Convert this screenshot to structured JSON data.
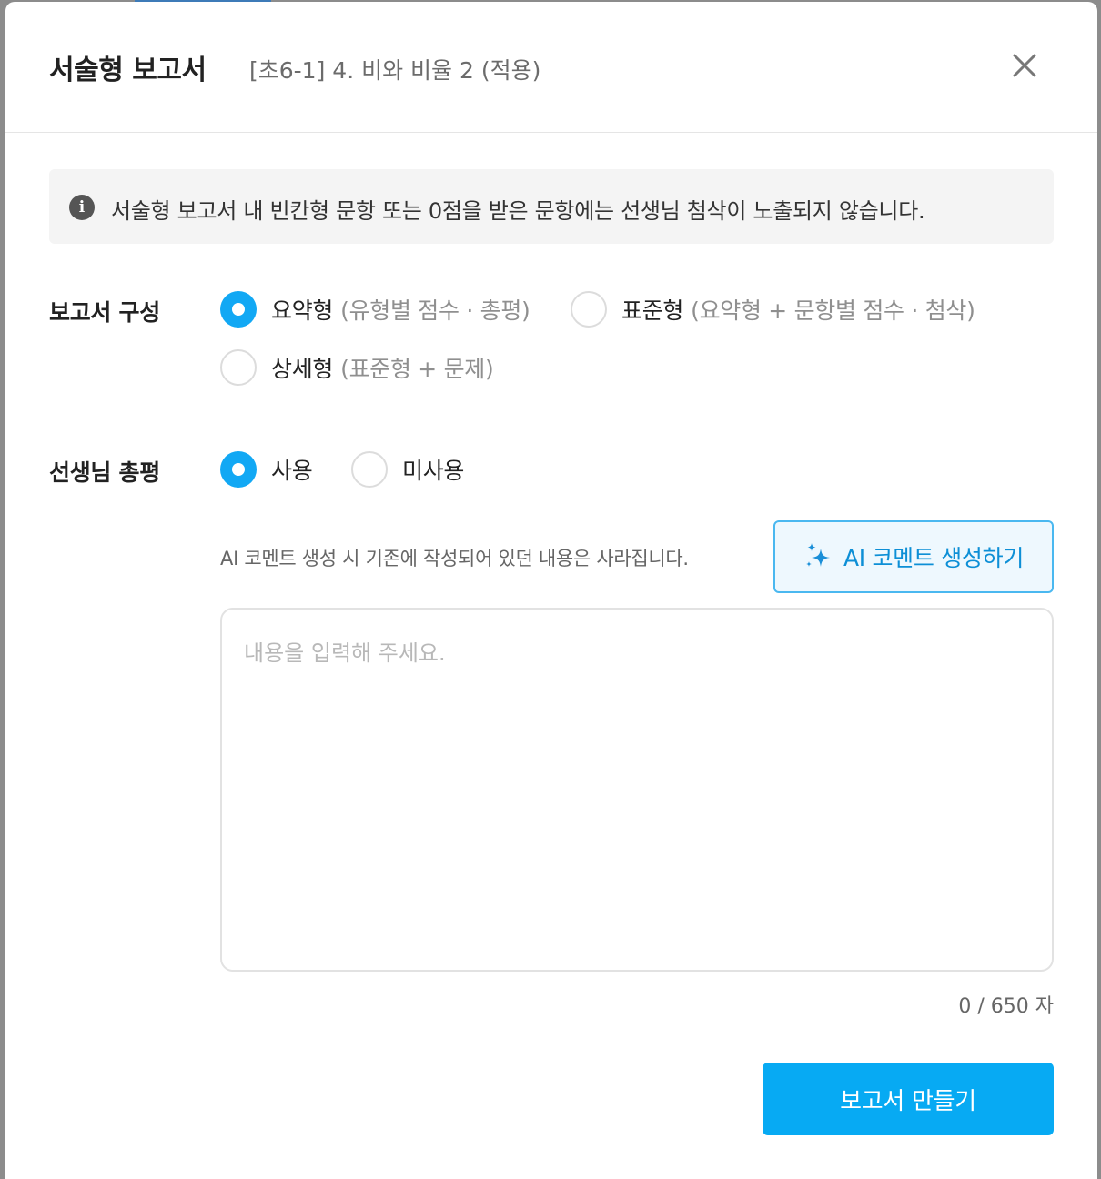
{
  "modal": {
    "title": "서술형 보고서",
    "subtitle": "[초6-1] 4. 비와 비율 2 (적용)"
  },
  "notice": {
    "icon": "info-icon",
    "text": "서술형 보고서 내 빈칸형 문항 또는 0점을 받은 문항에는 선생님 첨삭이 노출되지 않습니다."
  },
  "report_type": {
    "label": "보고서 구성",
    "selected": "요약형",
    "options": [
      {
        "label": "요약형",
        "sub": "(유형별 점수 · 총평)",
        "checked": true
      },
      {
        "label": "표준형",
        "sub": "(요약형 + 문항별 점수 · 첨삭)",
        "checked": false
      },
      {
        "label": "상세형",
        "sub": "(표준형 + 문제)",
        "checked": false
      }
    ]
  },
  "teacher_comment": {
    "label": "선생님 총평",
    "selected": "사용",
    "options": [
      {
        "label": "사용",
        "checked": true
      },
      {
        "label": "미사용",
        "checked": false
      }
    ],
    "ai_hint": "AI 코멘트 생성 시 기존에 작성되어 있던 내용은 사라집니다.",
    "ai_button": "AI 코멘트 생성하기",
    "placeholder": "내용을 입력해 주세요.",
    "value": "",
    "count": "0",
    "max": "650",
    "count_unit": "자"
  },
  "submit_label": "보고서 만들기",
  "colors": {
    "accent": "#07aaf3",
    "ai_button_text": "#0d8fd6",
    "ai_button_bg": "#eef8fe"
  }
}
